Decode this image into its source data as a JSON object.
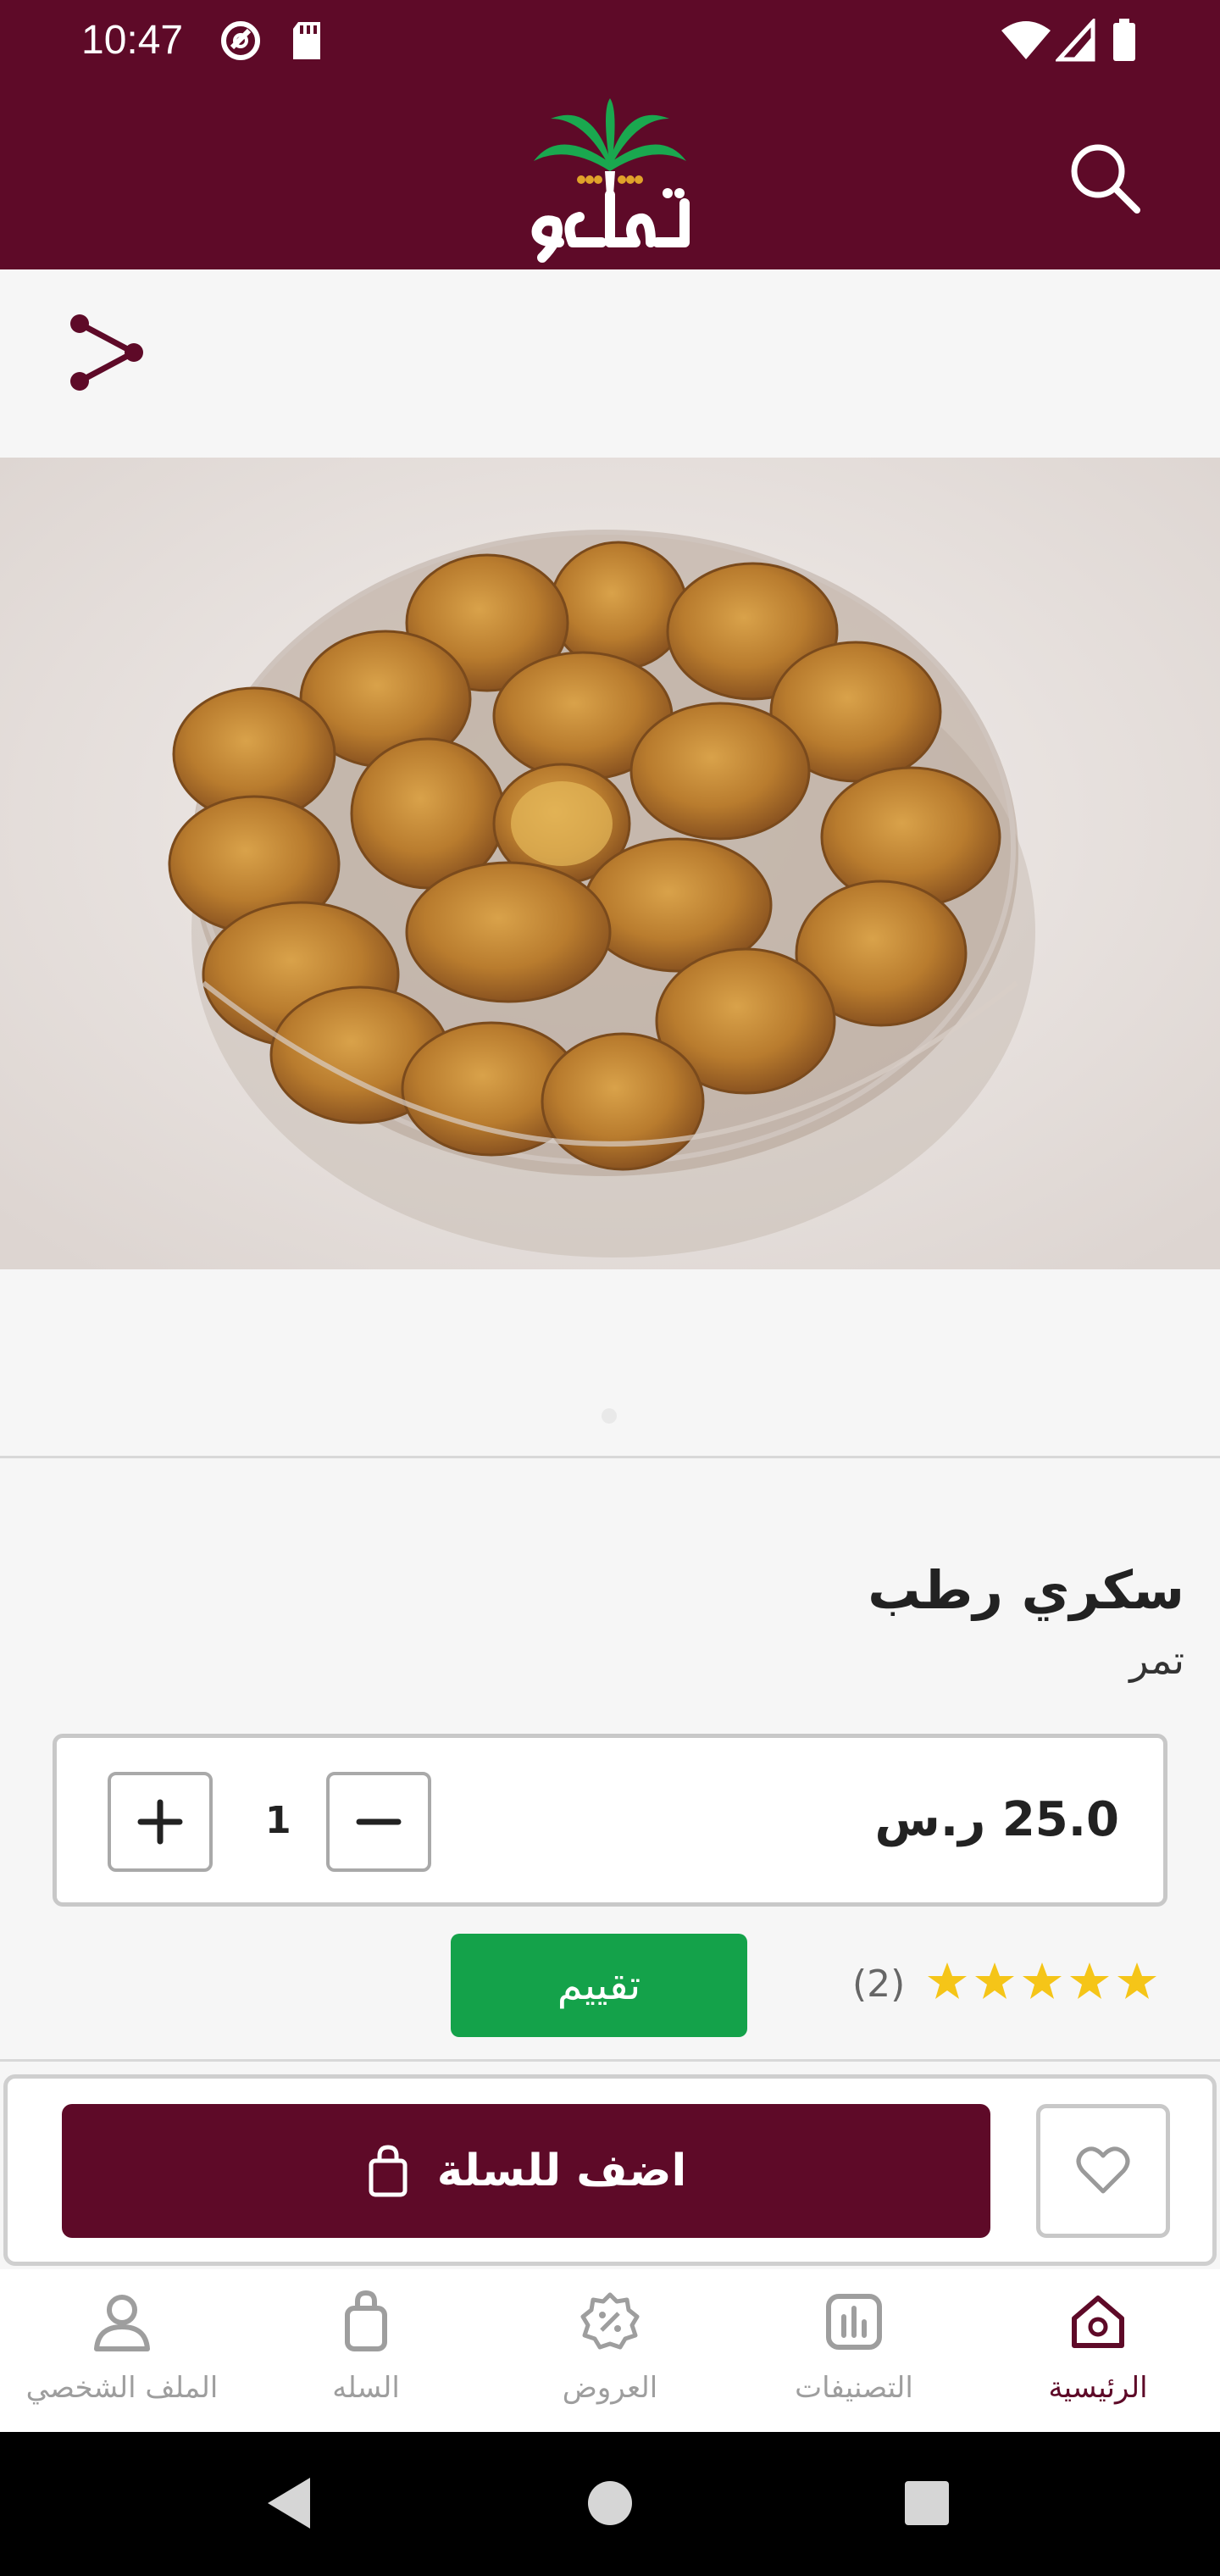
{
  "status_bar": {
    "time": "10:47"
  },
  "header": {
    "logo_text": "تمراكو"
  },
  "product": {
    "name": "سكري رطب",
    "category": "تمر",
    "price": "25.0 ر.س",
    "quantity": "1",
    "rating_count": "(2)",
    "rating_stars": 5,
    "rate_button": "تقييم"
  },
  "actions": {
    "add_to_cart": "اضف للسلة"
  },
  "bottom_nav": {
    "home": "الرئيسية",
    "categories": "التصنيفات",
    "offers": "العروض",
    "cart": "السله",
    "profile": "الملف الشخصي"
  },
  "colors": {
    "brand": "#5e0a28",
    "rate_button": "#14a24a",
    "stars": "#f5c518"
  }
}
